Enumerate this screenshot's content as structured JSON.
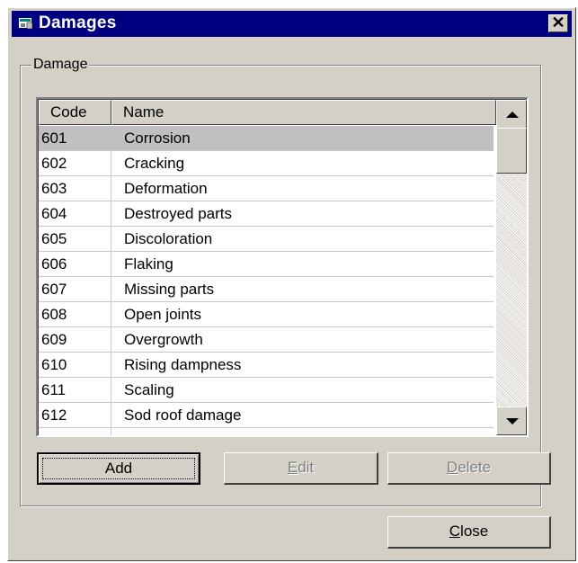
{
  "window": {
    "title": "Damages",
    "close_glyph": "✕",
    "icon": "window-app-icon"
  },
  "group": {
    "label": "Damage"
  },
  "list": {
    "columns": [
      "Code",
      "Name"
    ],
    "rows": [
      {
        "code": "601",
        "name": "Corrosion"
      },
      {
        "code": "602",
        "name": "Cracking"
      },
      {
        "code": "603",
        "name": "Deformation"
      },
      {
        "code": "604",
        "name": "Destroyed parts"
      },
      {
        "code": "605",
        "name": "Discoloration"
      },
      {
        "code": "606",
        "name": "Flaking"
      },
      {
        "code": "607",
        "name": "Missing parts"
      },
      {
        "code": "608",
        "name": "Open joints"
      },
      {
        "code": "609",
        "name": "Overgrowth"
      },
      {
        "code": "610",
        "name": "Rising dampness"
      },
      {
        "code": "611",
        "name": "Scaling"
      },
      {
        "code": "612",
        "name": "Sod roof damage"
      }
    ],
    "selected_index": 0
  },
  "buttons": {
    "add": {
      "label": "Add",
      "enabled": true
    },
    "edit": {
      "label": "Edit",
      "enabled": false,
      "mnemonic": "E"
    },
    "delete": {
      "label": "Delete",
      "enabled": false,
      "mnemonic": "D"
    },
    "close": {
      "label": "Close",
      "enabled": true,
      "mnemonic": "C"
    }
  },
  "colors": {
    "titlebar": "#000080",
    "face": "#d4d0c8"
  }
}
